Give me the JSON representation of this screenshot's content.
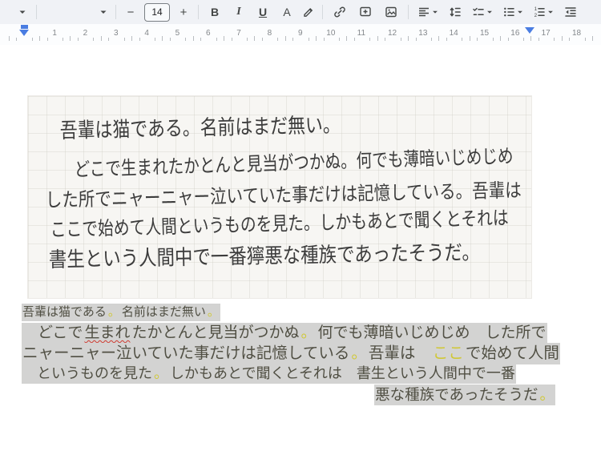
{
  "toolbar": {
    "font_size": "14",
    "minus_label": "−",
    "plus_label": "+",
    "bold_label": "B",
    "italic_label": "I",
    "underline_label": "U",
    "text_color_label": "A",
    "icon_names": [
      "styles-dropdown-caret",
      "font-family-dropdown-caret",
      "decrease-font-size",
      "font-size-value",
      "increase-font-size",
      "bold",
      "italic",
      "underline",
      "text-color",
      "highlight-pen",
      "insert-link",
      "add-comment",
      "insert-image",
      "align",
      "line-spacing",
      "checklist",
      "bulleted-list",
      "numbered-list",
      "indent"
    ]
  },
  "ruler": {
    "unit_labels": [
      "1",
      "2",
      "3",
      "4",
      "5",
      "6",
      "7",
      "8",
      "9",
      "10",
      "11",
      "12",
      "13",
      "14",
      "15",
      "16",
      "17",
      "18"
    ],
    "left_indent_unit": 0,
    "right_indent_unit": 16.45,
    "marker_color": "#4a7de2"
  },
  "handwriting_image": {
    "description": "handwritten Japanese note on faint grid paper",
    "lines": [
      "吾輩は猫である。名前はまだ無い。",
      "どこで生まれたかとんと見当がつかぬ。何でも薄暗いじめじめ",
      "した所でニャーニャー泣いていた事だけは記憶している。吾輩は",
      "ここで始めて人間というものを見た。しかもあとで聞くとそれは",
      "書生という人間中で一番獰悪な種族であったそうだ。"
    ]
  },
  "ocr_text": {
    "highlight_color": "#d3d3d2",
    "low_confidence_color": "#d0c838",
    "misspell_underline_color": "#cf3a30",
    "lines": [
      {
        "align": "left",
        "segments": [
          {
            "t": "吾輩は猫である",
            "s": "n"
          },
          {
            "t": "。",
            "s": "y"
          },
          {
            "t": "名前はまだ無い",
            "s": "n"
          },
          {
            "t": "。",
            "s": "y"
          }
        ]
      },
      {
        "align": "left",
        "segments": [
          {
            "t": "　どこで",
            "s": "n"
          },
          {
            "t": "生まれ",
            "s": "r"
          },
          {
            "t": "たかとんと見当がつかぬ",
            "s": "n"
          },
          {
            "t": "。",
            "s": "y"
          },
          {
            "t": "何でも薄暗いじめじめ　した所で",
            "s": "n"
          }
        ]
      },
      {
        "align": "left",
        "segments": [
          {
            "t": "ニャーニャー泣いていた事だけは記憶している",
            "s": "n"
          },
          {
            "t": "。",
            "s": "y"
          },
          {
            "t": "吾輩は　",
            "s": "n"
          },
          {
            "t": "ここ",
            "s": "y"
          },
          {
            "t": "で始めて人間",
            "s": "n"
          }
        ]
      },
      {
        "align": "left",
        "segments": [
          {
            "t": "　というものを見た",
            "s": "n"
          },
          {
            "t": "。",
            "s": "y"
          },
          {
            "t": "しかもあとで聞くとそれは　書生という人間中で一番",
            "s": "n"
          }
        ]
      },
      {
        "align": "right",
        "segments": [
          {
            "t": "悪な種族であったそうだ",
            "s": "n"
          },
          {
            "t": "。",
            "s": "y"
          }
        ]
      }
    ]
  }
}
